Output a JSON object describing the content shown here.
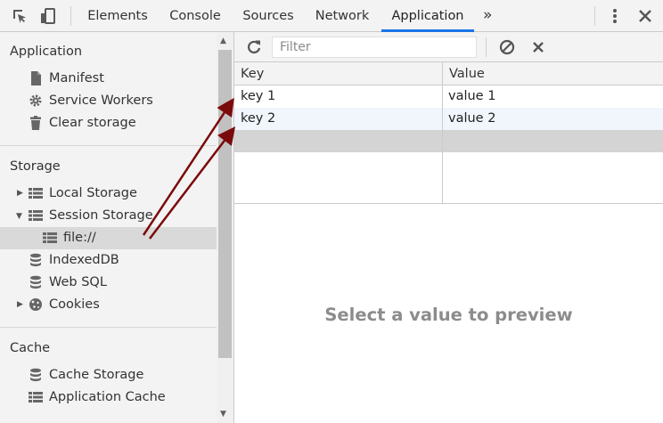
{
  "toolbar": {
    "tabs": [
      {
        "label": "Elements"
      },
      {
        "label": "Console"
      },
      {
        "label": "Sources"
      },
      {
        "label": "Network"
      },
      {
        "label": "Application"
      }
    ],
    "more_label": "»",
    "icons": {
      "inspect": "inspect-element-icon",
      "device": "device-toolbar-icon",
      "menu": "kebab-menu-icon",
      "close": "close-icon"
    }
  },
  "sidebar": {
    "application": {
      "title": "Application",
      "items": [
        {
          "label": "Manifest",
          "icon": "file-icon"
        },
        {
          "label": "Service Workers",
          "icon": "gear-icon"
        },
        {
          "label": "Clear storage",
          "icon": "trash-icon"
        }
      ]
    },
    "storage": {
      "title": "Storage",
      "items": [
        {
          "label": "Local Storage",
          "icon": "grid-icon",
          "expanded": false
        },
        {
          "label": "Session Storage",
          "icon": "grid-icon",
          "expanded": true
        },
        {
          "label": "file://",
          "icon": "grid-icon",
          "selected": true
        },
        {
          "label": "IndexedDB",
          "icon": "database-icon"
        },
        {
          "label": "Web SQL",
          "icon": "database-icon"
        },
        {
          "label": "Cookies",
          "icon": "cookie-icon",
          "expanded": false
        }
      ]
    },
    "cache": {
      "title": "Cache",
      "items": [
        {
          "label": "Cache Storage",
          "icon": "database-icon"
        },
        {
          "label": "Application Cache",
          "icon": "grid-icon"
        }
      ]
    }
  },
  "storage_view": {
    "filter_placeholder": "Filter",
    "columns": {
      "key": "Key",
      "value": "Value"
    },
    "rows": [
      {
        "key": "key 1",
        "value": "value 1"
      },
      {
        "key": "key 2",
        "value": "value 2"
      }
    ],
    "preview_text": "Select a value to preview"
  },
  "colors": {
    "accent": "#1a73e8",
    "annotation_arrow": "#7b0a0a",
    "selected_row": "#d9d9d9"
  }
}
